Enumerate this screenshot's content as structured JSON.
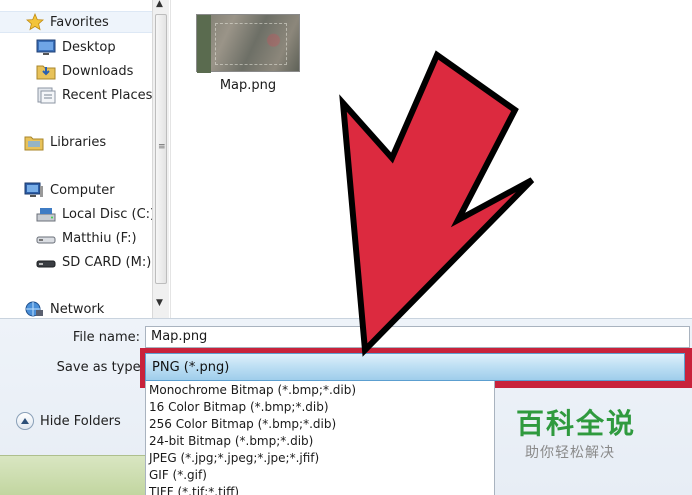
{
  "sidebar": {
    "favorites": "Favorites",
    "desktop": "Desktop",
    "downloads": "Downloads",
    "recent_places": "Recent Places",
    "libraries": "Libraries",
    "computer": "Computer",
    "local_disc": "Local Disc (C:)",
    "matthiu": "Matthiu (F:)",
    "sd_card": "SD CARD (M:)",
    "network": "Network"
  },
  "file_area": {
    "thumbnail_name": "Map.png"
  },
  "form": {
    "file_name_label": "File name:",
    "file_name_value": "Map.png",
    "save_as_type_label": "Save as type:",
    "save_as_type_value": "PNG (*.png)",
    "hide_folders": "Hide Folders"
  },
  "type_options": [
    "Monochrome Bitmap (*.bmp;*.dib)",
    "16 Color Bitmap (*.bmp;*.dib)",
    "256 Color Bitmap (*.bmp;*.dib)",
    "24-bit Bitmap (*.bmp;*.dib)",
    "JPEG (*.jpg;*.jpeg;*.jpe;*.jfif)",
    "GIF (*.gif)",
    "TIFF (*.tif;*.tiff)"
  ],
  "watermark": {
    "main": "百科全说",
    "sub": "助你轻松解决"
  },
  "colors": {
    "arrow_red": "#dc2a3f",
    "highlight_frame": "#c8223b",
    "watermark_green": "#2f9a3e"
  }
}
